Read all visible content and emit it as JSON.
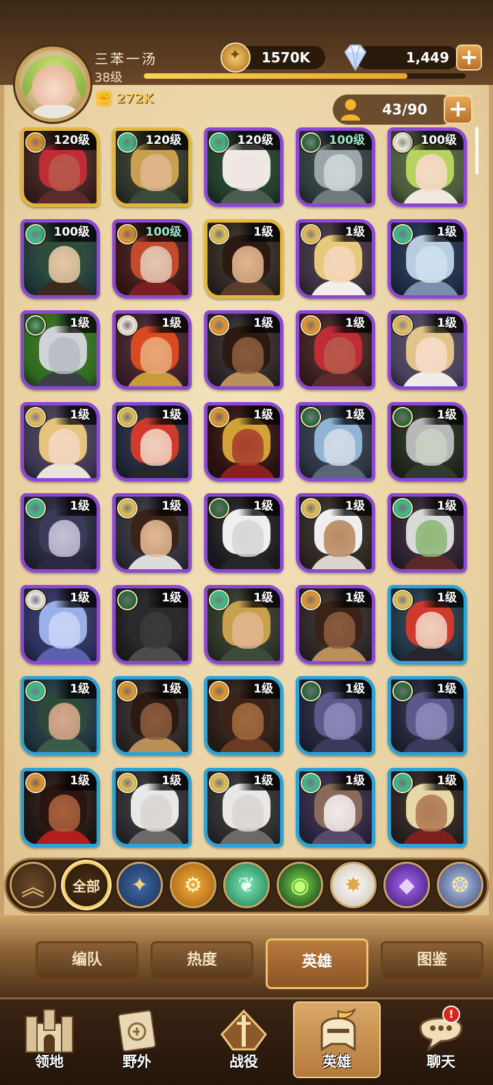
{
  "player": {
    "name": "三苯一汤",
    "level": "38级",
    "power": "272K",
    "xp_fraction": 0.82
  },
  "resources": {
    "gold": "1570K",
    "gems": "1,449",
    "plus_label": "+"
  },
  "roster": {
    "capacity": "43/90"
  },
  "faction_colors": {
    "lightbearer": "#e7c25a",
    "mauler": "#e59a2e",
    "wilder": "#3fbf8a",
    "graveborn": "#2f6b3a",
    "celestial": "#f2ede0",
    "hypogean": "#7a3cc0",
    "dimensional": "#6d84b8"
  },
  "heroes": [
    {
      "level": "120级",
      "faction": "mauler",
      "rarity": "gold",
      "skin": "#b8584a",
      "hair": "#c02c36",
      "cloth": "#5b2a2a",
      "bg": "#3a1e1e"
    },
    {
      "level": "120级",
      "faction": "wilder",
      "rarity": "gold",
      "skin": "#e0b58d",
      "hair": "#c9a14e",
      "cloth": "#3b4a3a",
      "bg": "#2b3327"
    },
    {
      "level": "120级",
      "faction": "wilder",
      "rarity": "purple",
      "skin": "#f0e6e6",
      "hair": "#efe9e4",
      "cloth": "#4a5b52",
      "bg": "#1f3b2a"
    },
    {
      "level": "100级",
      "faction": "graveborn",
      "rarity": "purple",
      "skin": "#cfd6d8",
      "hair": "#9aa6aa",
      "cloth": "#6f7a7d",
      "bg": "#2e3a3d",
      "lvl_style": "teal"
    },
    {
      "level": "100级",
      "faction": "celestial",
      "rarity": "purple",
      "skin": "#f6d9c6",
      "hair": "#b6d35e",
      "cloth": "#efe9df",
      "bg": "#4a5a3a"
    },
    {
      "level": "100级",
      "faction": "wilder",
      "rarity": "purple",
      "skin": "#e8c8a5",
      "hair": "#2d4c3a",
      "cloth": "#3e2a1c",
      "bg": "#1e3b3a"
    },
    {
      "level": "100级",
      "faction": "mauler",
      "rarity": "purple",
      "skin": "#e2c7b3",
      "hair": "#c24b2d",
      "cloth": "#7a2020",
      "bg": "#3a1616",
      "lvl_style": "teal"
    },
    {
      "level": "1级",
      "faction": "lightbearer",
      "rarity": "gold",
      "skin": "#e4b68f",
      "hair": "#2b1a12",
      "cloth": "#5b3b2b",
      "bg": "#2b2420"
    },
    {
      "level": "1级",
      "faction": "lightbearer",
      "rarity": "purple",
      "skin": "#f4d7bb",
      "hair": "#e8c87a",
      "cloth": "#f2efe9",
      "bg": "#3b2f3f"
    },
    {
      "level": "1级",
      "faction": "wilder",
      "rarity": "purple",
      "skin": "#cfe0ef",
      "hair": "#b9cde2",
      "cloth": "#7a8fb0",
      "bg": "#1d2c48"
    },
    {
      "level": "1级",
      "faction": "graveborn",
      "rarity": "purple",
      "skin": "#b7bdc2",
      "hair": "#cfd3d6",
      "cloth": "#3c3f43",
      "bg": "#2e6a1e"
    },
    {
      "level": "1级",
      "faction": "celestial",
      "rarity": "purple",
      "skin": "#e8a878",
      "hair": "#d84a22",
      "cloth": "#c89a3a",
      "bg": "#3c1e2a"
    },
    {
      "level": "1级",
      "faction": "mauler",
      "rarity": "purple",
      "skin": "#8a5a3c",
      "hair": "#2a1a12",
      "cloth": "#b89058",
      "bg": "#2a2426"
    },
    {
      "level": "1级",
      "faction": "mauler",
      "rarity": "purple",
      "skin": "#b8584a",
      "hair": "#c02c36",
      "cloth": "#5b2a2a",
      "bg": "#3a1e1e"
    },
    {
      "level": "1级",
      "faction": "lightbearer",
      "rarity": "purple",
      "skin": "#f6dcc8",
      "hair": "#e2c48a",
      "cloth": "#f1ede6",
      "bg": "#46405a"
    },
    {
      "level": "1级",
      "faction": "lightbearer",
      "rarity": "purple",
      "skin": "#f4d7c0",
      "hair": "#e6c47e",
      "cloth": "#eae3da",
      "bg": "#3c3752"
    },
    {
      "level": "1级",
      "faction": "lightbearer",
      "rarity": "purple",
      "skin": "#f1d1bf",
      "hair": "#d03a2d",
      "cloth": "#26262e",
      "bg": "#1f2638"
    },
    {
      "level": "1级",
      "faction": "mauler",
      "rarity": "purple",
      "skin": "#a8402c",
      "hair": "#d2a236",
      "cloth": "#8e1f1f",
      "bg": "#2a0f0f"
    },
    {
      "level": "1级",
      "faction": "graveborn",
      "rarity": "purple",
      "skin": "#d3dbe6",
      "hair": "#8fb4d6",
      "cloth": "#5a6578",
      "bg": "#2a3444"
    },
    {
      "level": "1级",
      "faction": "graveborn",
      "rarity": "purple",
      "skin": "#c9d1c4",
      "hair": "#b8b8b8",
      "cloth": "#2f3b2c",
      "bg": "#1e261c"
    },
    {
      "level": "1级",
      "faction": "wilder",
      "rarity": "purple",
      "skin": "#c7c1d6",
      "hair": "#3a3a5a",
      "cloth": "#2a2a44",
      "bg": "#22243a"
    },
    {
      "level": "1级",
      "faction": "lightbearer",
      "rarity": "purple",
      "skin": "#e3b894",
      "hair": "#3a2418",
      "cloth": "#dcdcdc",
      "bg": "#2c2c38"
    },
    {
      "level": "1级",
      "faction": "graveborn",
      "rarity": "purple",
      "skin": "#d7d7d7",
      "hair": "#efefef",
      "cloth": "#26262a",
      "bg": "#1a1a1e"
    },
    {
      "level": "1级",
      "faction": "lightbearer",
      "rarity": "purple",
      "skin": "#b98a62",
      "hair": "#efefef",
      "cloth": "#d9d4cc",
      "bg": "#2c2622"
    },
    {
      "level": "1级",
      "faction": "wilder",
      "rarity": "purple",
      "skin": "#8fb87a",
      "hair": "#d9d9d9",
      "cloth": "#5a2a2a",
      "bg": "#2a2030"
    },
    {
      "level": "1级",
      "faction": "celestial",
      "rarity": "purple",
      "skin": "#c8d3f5",
      "hair": "#9ab0e6",
      "cloth": "#5a62b0",
      "bg": "#2a2e5c"
    },
    {
      "level": "1级",
      "faction": "graveborn",
      "rarity": "purple",
      "skin": "#3a3a3a",
      "hair": "#2a2a2a",
      "cloth": "#4b4b4b",
      "bg": "#1e1e22"
    },
    {
      "level": "1级",
      "faction": "wilder",
      "rarity": "purple",
      "skin": "#e0b58d",
      "hair": "#c9a14e",
      "cloth": "#3b4a3a",
      "bg": "#2b3327"
    },
    {
      "level": "1级",
      "faction": "mauler",
      "rarity": "purple",
      "skin": "#8a5a3c",
      "hair": "#3a2218",
      "cloth": "#b89058",
      "bg": "#2a2426"
    },
    {
      "level": "1级",
      "faction": "lightbearer",
      "rarity": "blue",
      "skin": "#f1d1bf",
      "hair": "#d03a2d",
      "cloth": "#26262e",
      "bg": "#1f3444"
    },
    {
      "level": "1级",
      "faction": "wilder",
      "rarity": "blue",
      "skin": "#d9a88a",
      "hair": "#2c4a3a",
      "cloth": "#3a5a4a",
      "bg": "#1e3440"
    },
    {
      "level": "1级",
      "faction": "mauler",
      "rarity": "blue",
      "skin": "#8a5a3c",
      "hair": "#2a1a12",
      "cloth": "#b89058",
      "bg": "#2a2426"
    },
    {
      "level": "1级",
      "faction": "mauler",
      "rarity": "blue",
      "skin": "#a0693e",
      "hair": "#3a2218",
      "cloth": "#6a3a22",
      "bg": "#2a1c16"
    },
    {
      "level": "1级",
      "faction": "graveborn",
      "rarity": "blue",
      "skin": "#8b88b8",
      "hair": "#5a5a8a",
      "cloth": "#3a3a5a",
      "bg": "#1e2238"
    },
    {
      "level": "1级",
      "faction": "graveborn",
      "rarity": "blue",
      "skin": "#8b88b8",
      "hair": "#5a5a8a",
      "cloth": "#3a3a5a",
      "bg": "#1e2238"
    },
    {
      "level": "1级",
      "faction": "mauler",
      "rarity": "blue",
      "skin": "#a8603c",
      "hair": "#2a1410",
      "cloth": "#b01e1e",
      "bg": "#1e1414"
    },
    {
      "level": "1级",
      "faction": "lightbearer",
      "rarity": "blue",
      "skin": "#dcd6d2",
      "hair": "#e8e8e8",
      "cloth": "#6a6a6a",
      "bg": "#2a2a2e"
    },
    {
      "level": "1级",
      "faction": "lightbearer",
      "rarity": "blue",
      "skin": "#dcd6d2",
      "hair": "#e8e8e8",
      "cloth": "#6a6a6a",
      "bg": "#2a2a2e"
    },
    {
      "level": "1级",
      "faction": "wilder",
      "rarity": "blue",
      "skin": "#f0ece8",
      "hair": "#8a6a5a",
      "cloth": "#5a4a6a",
      "bg": "#2c2440"
    },
    {
      "level": "1级",
      "faction": "wilder",
      "rarity": "blue",
      "skin": "#b07a54",
      "hair": "#e8d8a8",
      "cloth": "#7a2020",
      "bg": "#2a2020"
    }
  ],
  "filters": {
    "all_label": "全部",
    "items": [
      "toggle",
      "all",
      "lightbearer",
      "mauler",
      "wilder",
      "graveborn",
      "celestial",
      "hypogean",
      "dimensional"
    ]
  },
  "subtabs": {
    "formation": "编队",
    "popularity": "热度",
    "heroes": "英雄",
    "codex": "图鉴"
  },
  "bottom_nav": {
    "territory": "领地",
    "wild": "野外",
    "campaign": "战役",
    "heroes": "英雄",
    "chat": "聊天",
    "chat_badge": "!"
  }
}
